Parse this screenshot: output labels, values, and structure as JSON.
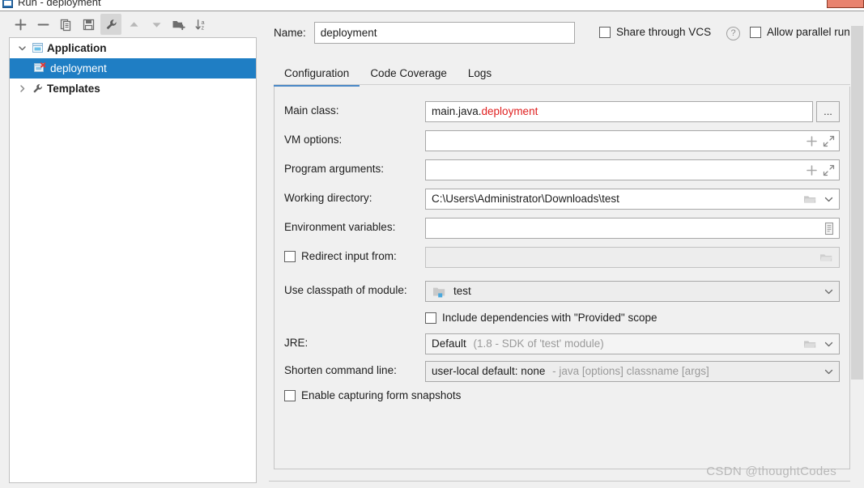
{
  "window": {
    "title": "Run - deployment",
    "icon": "run-configurations-icon",
    "close_button": "close-window-button"
  },
  "toolbar": {
    "buttons": [
      {
        "name": "add-configuration-button",
        "icon": "plus-icon",
        "tooltip": "Add New Configuration",
        "selected": false
      },
      {
        "name": "remove-configuration-button",
        "icon": "minus-icon",
        "tooltip": "Remove Configuration",
        "selected": false
      },
      {
        "name": "copy-configuration-button",
        "icon": "copy-icon",
        "tooltip": "Copy Configuration",
        "selected": false
      },
      {
        "name": "save-configuration-button",
        "icon": "save-icon",
        "tooltip": "Save Configuration",
        "selected": false
      },
      {
        "name": "edit-templates-button",
        "icon": "wrench-icon",
        "tooltip": "Edit Templates",
        "selected": true
      },
      {
        "name": "move-up-button",
        "icon": "arrow-up-icon",
        "tooltip": "Move Up",
        "selected": false
      },
      {
        "name": "move-down-button",
        "icon": "arrow-down-icon",
        "tooltip": "Move Down",
        "selected": false
      },
      {
        "name": "new-folder-button",
        "icon": "new-folder-icon",
        "tooltip": "Create New Folder",
        "selected": false
      },
      {
        "name": "sort-configurations-button",
        "icon": "sort-az-icon",
        "tooltip": "Sort Configurations",
        "selected": false
      }
    ]
  },
  "tree": {
    "nodes": [
      {
        "label": "Application",
        "expanded": true,
        "selected": false,
        "icon": "application-icon",
        "bold": true,
        "level": 0,
        "error": false
      },
      {
        "label": "deployment",
        "expanded": null,
        "selected": true,
        "icon": "application-icon",
        "bold": false,
        "level": 1,
        "error": true
      },
      {
        "label": "Templates",
        "expanded": false,
        "selected": false,
        "icon": "wrench-icon",
        "bold": true,
        "level": 0,
        "error": false
      }
    ]
  },
  "header": {
    "name_label": "Name:",
    "name_value": "deployment",
    "share_vcs_label": "Share through VCS",
    "share_vcs_checked": false,
    "help_glyph": "?",
    "allow_parallel_label": "Allow parallel run",
    "allow_parallel_checked": false
  },
  "tabs": [
    {
      "label": "Configuration",
      "active": true
    },
    {
      "label": "Code Coverage",
      "active": false
    },
    {
      "label": "Logs",
      "active": false
    }
  ],
  "form": {
    "main_class": {
      "label": "Main class:",
      "value_prefix": "main.java.",
      "value_error": "deployment",
      "browse_label": "..."
    },
    "vm_options": {
      "label": "VM options:",
      "value": "",
      "macro_icon": "plus-icon",
      "expand_icon": "expand-diagonal-icon"
    },
    "program_arguments": {
      "label": "Program arguments:",
      "value": "",
      "macro_icon": "plus-icon",
      "expand_icon": "expand-diagonal-icon"
    },
    "working_directory": {
      "label": "Working directory:",
      "value": "C:\\Users\\Administrator\\Downloads\\test",
      "browse_icon": "folder-icon",
      "dropdown_icon": "chevron-down-icon"
    },
    "environment_variables": {
      "label": "Environment variables:",
      "value": "",
      "edit_icon": "list-edit-icon"
    },
    "redirect_input": {
      "label": "Redirect input from:",
      "checked": false,
      "value": "",
      "browse_icon": "folder-icon"
    },
    "classpath_module": {
      "label": "Use classpath of module:",
      "value": "test",
      "module_icon": "module-icon",
      "dropdown_icon": "chevron-down-icon"
    },
    "include_provided": {
      "label": "Include dependencies with \"Provided\" scope",
      "checked": false
    },
    "jre": {
      "label": "JRE:",
      "value": "Default",
      "value_hint": "(1.8 - SDK of 'test' module)",
      "browse_icon": "folder-icon",
      "dropdown_icon": "chevron-down-icon"
    },
    "shorten_command_line": {
      "label": "Shorten command line:",
      "value": "user-local default: none",
      "value_hint": "- java [options] classname [args]",
      "dropdown_icon": "chevron-down-icon"
    },
    "capture_snapshots": {
      "label": "Enable capturing form snapshots",
      "checked": false
    }
  },
  "watermark": "CSDN @thoughtCodes",
  "colors": {
    "selection_blue": "#1f7ec4",
    "tab_accent": "#4a88c7",
    "error_red": "#e02020",
    "panel_bg": "#f0f0f0",
    "field_bg": "#ffffff",
    "disabled_bg": "#ededed",
    "hint_grey": "#9a9a9a",
    "close_button": "#e8836f"
  }
}
